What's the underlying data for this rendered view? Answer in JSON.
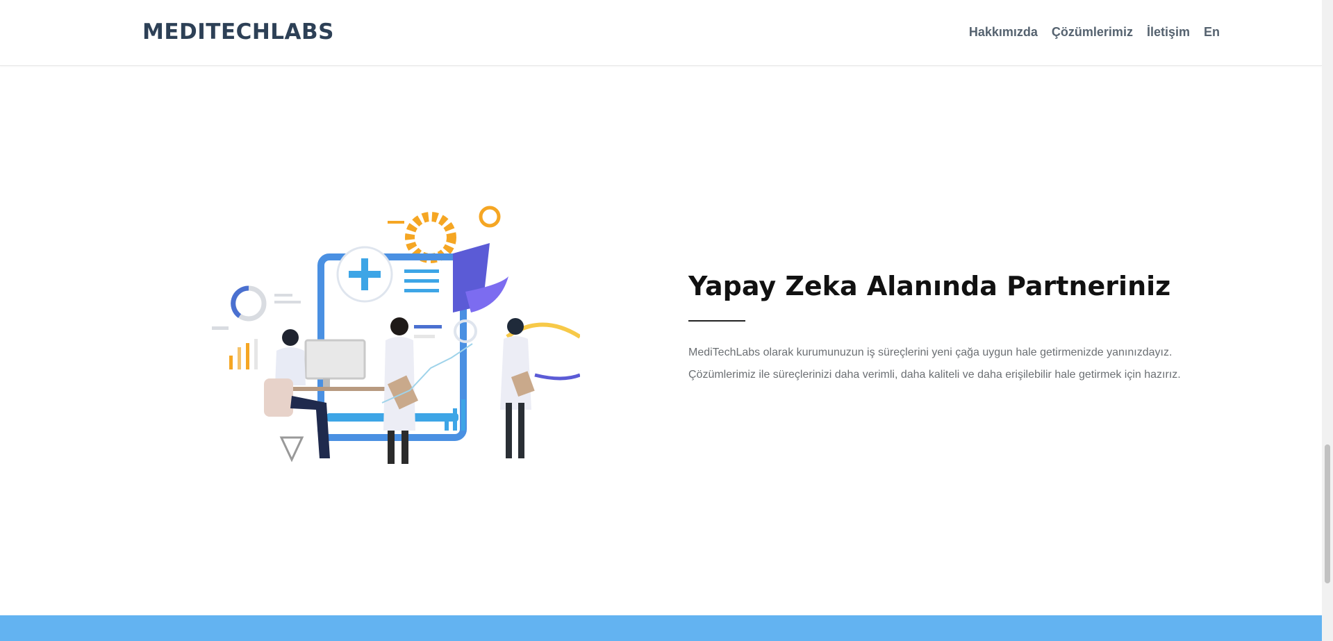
{
  "header": {
    "logo_text": "MEDITECHLABS",
    "nav": {
      "about": "Hakkımızda",
      "solutions": "Çözümlerimiz",
      "contact": "İletişim",
      "language": "En"
    }
  },
  "hero": {
    "title": "Yapay Zeka Alanında Partneriniz",
    "body": "MediTechLabs olarak kurumunuzun iş süreçlerini yeni çağa uygun hale getirmenizde yanınızdayız. Çözümlerimiz ile süreçlerinizi daha verimli, daha kaliteli ve daha erişilebilir hale getirmek için hazırız."
  },
  "colors": {
    "logo": "#2d4056",
    "nav_text": "#55626f",
    "heading": "#111111",
    "body_text": "#6b6f73",
    "footer_band": "#63b3f1",
    "accent_orange": "#f5a623",
    "accent_blue": "#4a90e2",
    "accent_purple": "#5b5bd6"
  },
  "icons": [
    "medical-team-illustration",
    "plus-icon",
    "gear-icon",
    "bar-chart-icon",
    "donut-chart-icon"
  ]
}
